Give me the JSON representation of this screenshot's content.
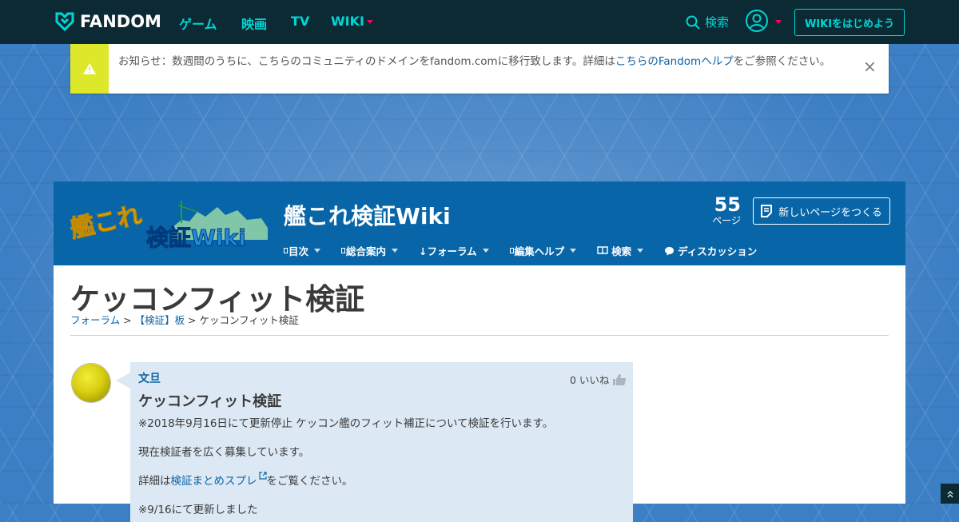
{
  "global_nav": {
    "brand": "FANDOM",
    "links": [
      "ゲーム",
      "映画",
      "TV"
    ],
    "wiki_menu": "WIKI",
    "search_label": "検索",
    "start_wiki_button": "WIKIをはじめよう",
    "accent_color": "#00d6d6",
    "bar_color": "#0b2a33"
  },
  "notice": {
    "text_before": "お知らせ：数週間のうちに、こちらのコミュニティのドメインをfandom.comに移行致します。詳細は",
    "link_text": "こちらのFandomヘルプ",
    "text_after": "をご参照ください。",
    "close_symbol": "×",
    "icon": "warning-icon"
  },
  "wiki_header": {
    "title": "艦これ検証Wiki",
    "page_count": "55",
    "page_count_label": "ページ",
    "new_page_button": "新しいページをつくる",
    "nav": [
      {
        "label": "目次",
        "icon": "square-icon"
      },
      {
        "label": "総合案内",
        "icon": "square-icon"
      },
      {
        "label": "↓フォーラム",
        "icon": ""
      },
      {
        "label": "編集ヘルプ",
        "icon": "square-icon"
      },
      {
        "label": "検索",
        "icon": "book-icon"
      },
      {
        "label": "ディスカッション",
        "icon": "chat-bubble-icon"
      }
    ],
    "header_color": "#0866a8"
  },
  "page": {
    "title": "ケッコンフィット検証",
    "breadcrumb": {
      "forum": "フォーラム",
      "sep1": " > ",
      "board": "【検証】板",
      "sep2": " > ",
      "current": "ケッコンフィット検証"
    }
  },
  "post": {
    "author": "文旦",
    "likes": "0 いいね",
    "title": "ケッコンフィット検証",
    "line1": "※2018年9月16日にて更新停止 ケッコン艦のフィット補正について検証を行います。",
    "line2": "現在検証者を広く募集しています。",
    "line3_before": "詳細は",
    "line3_link": "検証まとめスプレ",
    "line3_after": "をご覧ください。",
    "line4_partial": "※9/16にて更新しました"
  }
}
